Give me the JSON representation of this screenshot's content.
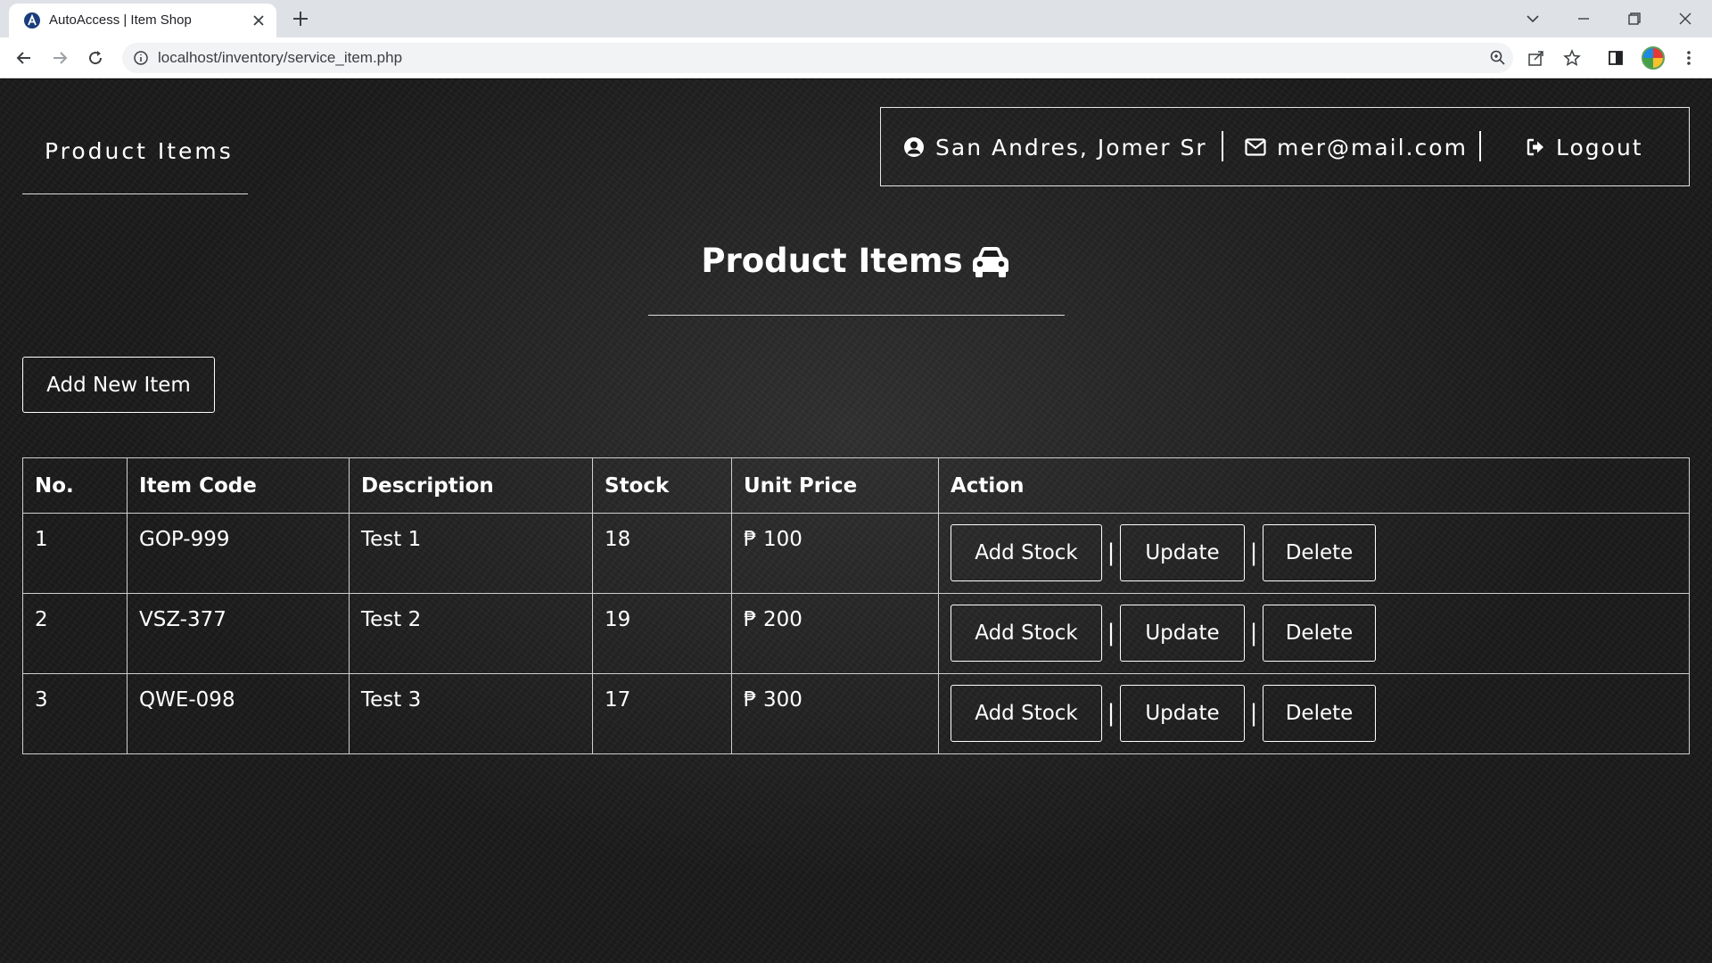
{
  "browser": {
    "tab_title": "AutoAccess | Item Shop",
    "url": "localhost/inventory/service_item.php"
  },
  "header": {
    "brand": "Product Items",
    "user_name": "San Andres, Jomer Sr",
    "user_email": "mer@mail.com",
    "logout_label": "Logout"
  },
  "main": {
    "title": "Product Items",
    "add_button_label": "Add New Item"
  },
  "table": {
    "columns": [
      "No.",
      "Item Code",
      "Description",
      "Stock",
      "Unit Price",
      "Action"
    ],
    "rows": [
      {
        "no": "1",
        "code": "GOP-999",
        "description": "Test 1",
        "stock": "18",
        "price": "₱ 100"
      },
      {
        "no": "2",
        "code": "VSZ-377",
        "description": "Test 2",
        "stock": "19",
        "price": "₱ 200"
      },
      {
        "no": "3",
        "code": "QWE-098",
        "description": "Test 3",
        "stock": "17",
        "price": "₱ 300"
      }
    ],
    "action_labels": {
      "add_stock": "Add Stock",
      "update": "Update",
      "delete": "Delete",
      "separator": "|"
    }
  },
  "colors": {
    "page_background": "#1b1b1b",
    "text": "#ffffff",
    "border": "#cfcfcf"
  },
  "icons": [
    "user-circle-icon",
    "envelope-icon",
    "logout-icon",
    "car-icon"
  ]
}
